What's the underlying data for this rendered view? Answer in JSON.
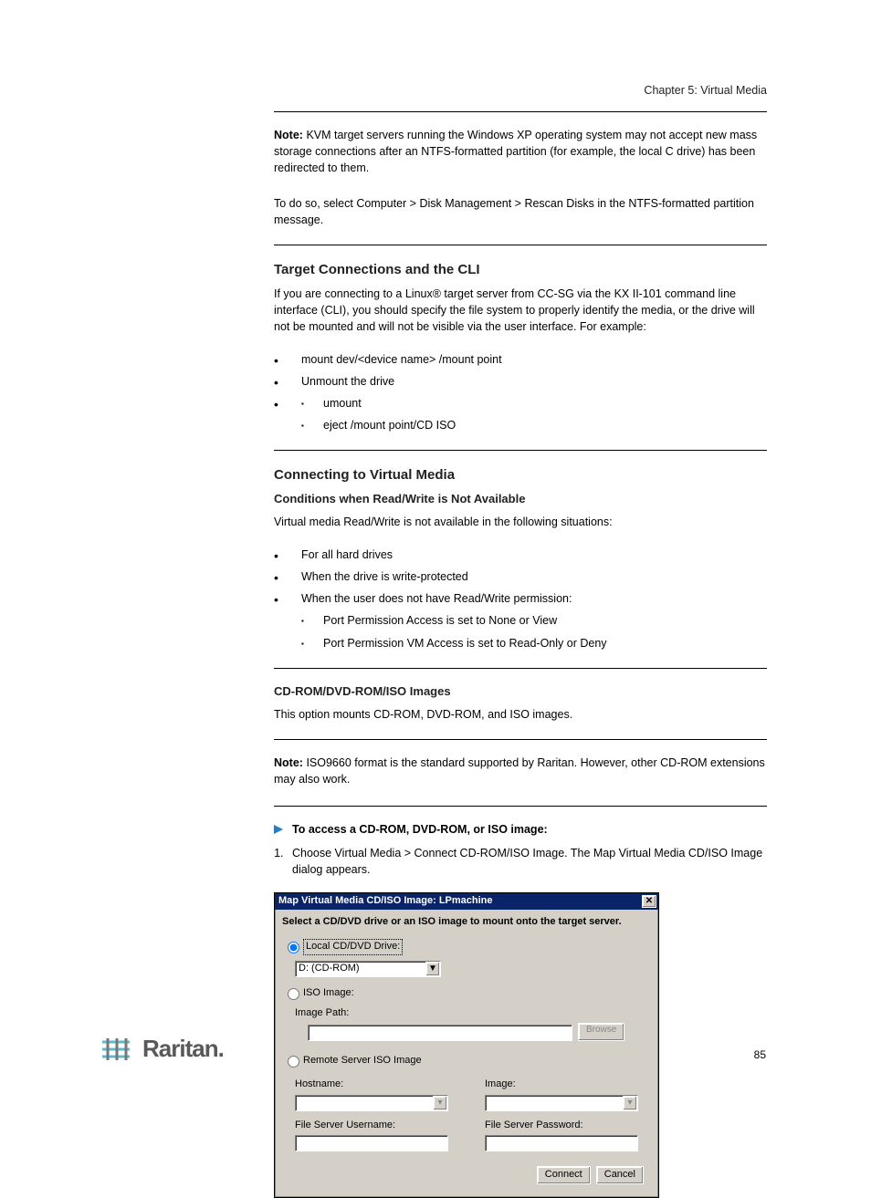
{
  "header": {
    "chapter_ref": "Chapter 5: Virtual Media"
  },
  "note": {
    "label": "Note:",
    "text": "KVM target servers running the Windows XP operating system may not accept new mass storage connections after an NTFS-formatted partition (for example, the local C drive) has been redirected to them."
  },
  "disconnect_tip": "To do so, select Computer > Disk Management > Rescan Disks in the NTFS-formatted partition message.",
  "tc_heading": "Target Connections and the CLI",
  "tc_intro": "If you are connecting to a Linux® target server from CC-SG via the KX II-101 command line interface (CLI), you should specify the file system to properly identify the media, or the drive will not be mounted and will not be visible via the user interface. For example:",
  "tc_commands": [
    "mount dev/<device name> /mount point",
    "Unmount the drive",
    [
      "umount",
      "eject /mount point/CD ISO"
    ]
  ],
  "cd_heading": "Connecting to Virtual Media",
  "cd_cond_head": "Conditions when Read/Write is Not Available",
  "cd_cond_intro": "Virtual media Read/Write is not available in the following situations:",
  "cd_cond_items": [
    "For all hard drives",
    "When the drive is write-protected",
    "When the user does not have Read/Write permission:",
    "Port Permission Access is set to None or View",
    "Port Permission VM Access is set to Read-Only or Deny"
  ],
  "cdrom_heading": "CD-ROM/DVD-ROM/ISO Images",
  "cdrom_intro": "This option mounts CD-ROM, DVD-ROM, and ISO images.",
  "cdrom_note": {
    "label": "Note:",
    "text": "ISO9660 format is the standard supported by Raritan. However, other CD-ROM extensions may also work."
  },
  "proc_head": "To access a CD-ROM, DVD-ROM, or ISO image:",
  "proc_steps": [
    "Choose Virtual Media > Connect CD-ROM/ISO Image. The Map Virtual Media CD/ISO Image dialog appears."
  ],
  "dialog": {
    "title": "Map Virtual Media CD/ISO Image: LPmachine",
    "prompt": "Select a CD/DVD drive or an ISO image to mount onto the target server.",
    "radio_local": "Local CD/DVD Drive:",
    "local_value": "D: (CD-ROM)",
    "radio_iso": "ISO Image:",
    "image_path_label": "Image Path:",
    "browse": "Browse",
    "radio_remote": "Remote Server ISO Image",
    "hostname_label": "Hostname:",
    "image_label": "Image:",
    "fs_user_label": "File Server Username:",
    "fs_pass_label": "File Server Password:",
    "connect": "Connect",
    "cancel": "Cancel"
  },
  "page_number": "85",
  "brand": "Raritan."
}
